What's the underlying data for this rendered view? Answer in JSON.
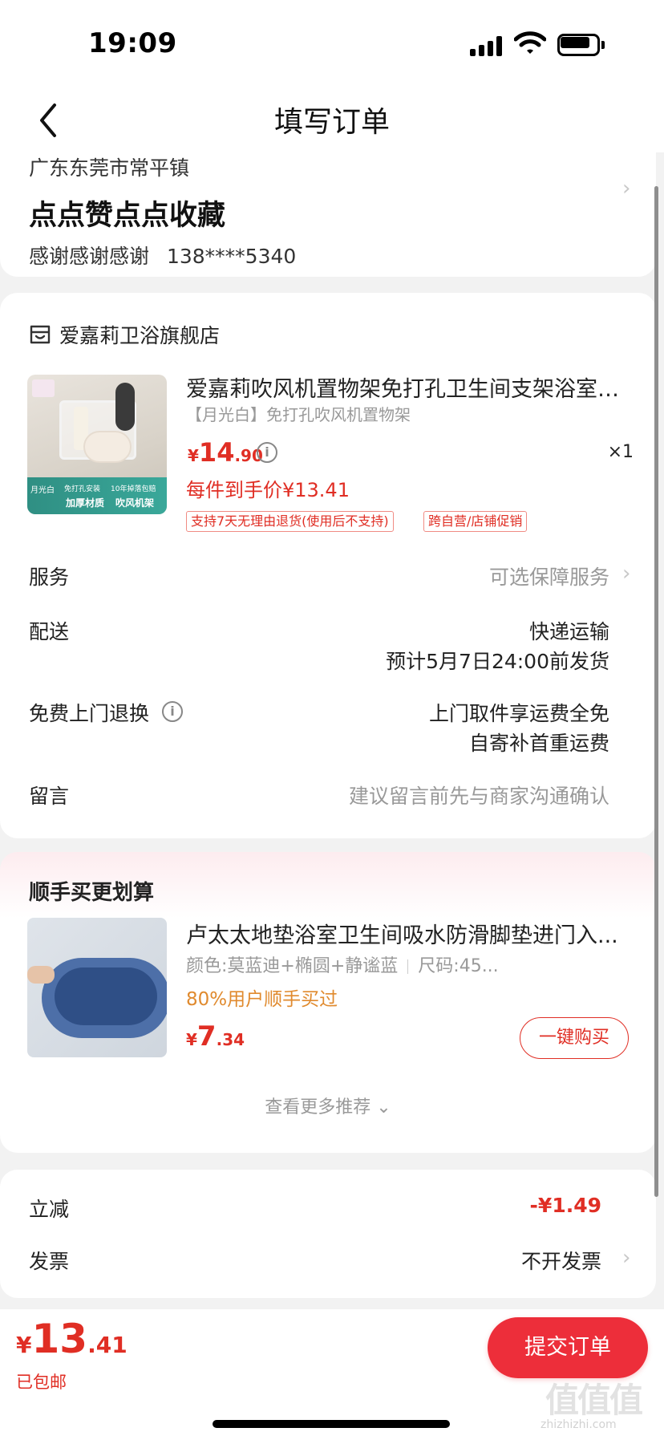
{
  "status_bar": {
    "time": "19:09"
  },
  "nav": {
    "title": "填写订单"
  },
  "address": {
    "region": "广东东莞市常平镇",
    "detail": "点点赞点点收藏",
    "name": "感谢感谢感谢",
    "phone": "138****5340"
  },
  "store": {
    "name": "爱嘉莉卫浴旗舰店"
  },
  "product": {
    "title": "爱嘉莉吹风机置物架免打孔卫生间支架浴室壁挂...",
    "spec": "【月光白】免打孔吹风机置物架",
    "price_symbol": "¥",
    "price_int": "14",
    "price_dec": ".90",
    "quantity": "×1",
    "unit_price": "每件到手价¥13.41",
    "tags": [
      "支持7天无理由退货(使用后不支持)",
      "跨自营/店铺促销"
    ],
    "image_labels": [
      "月光白",
      "免打孔安装",
      "10年掉落包赔",
      "加厚材质",
      "吹风机架"
    ]
  },
  "rows": {
    "service_label": "服务",
    "service_value": "可选保障服务",
    "delivery_label": "配送",
    "delivery_value": "快递运输",
    "delivery_eta": "预计5月7日24:00前发货",
    "return_label": "免费上门退换",
    "return_value_1": "上门取件享运费全免",
    "return_value_2": "自寄补首重运费",
    "message_label": "留言",
    "message_placeholder": "建议留言前先与商家沟通确认"
  },
  "upsell": {
    "title": "顺手买更划算",
    "item_title": "卢太太地垫浴室卫生间吸水防滑脚垫进门入...",
    "item_color": "颜色:莫蓝迪+椭圆+静谧蓝",
    "item_size": "尺码:45...",
    "buyers": "80%用户顺手买过",
    "price_symbol": "¥",
    "price_int": "7",
    "price_dec": ".34",
    "buy_label": "一键购买",
    "more_label": "查看更多推荐 ⌄"
  },
  "summary": {
    "discount_label": "立减",
    "discount_value": "-¥1.49",
    "invoice_label": "发票",
    "invoice_value": "不开发票"
  },
  "checkout": {
    "price_symbol": "¥",
    "price_int": "13",
    "price_dec": ".41",
    "shipping": "已包邮",
    "submit_label": "提交订单"
  },
  "watermark": {
    "text": "值值值",
    "sub": "zhizhizhi.com"
  },
  "colors": {
    "accent": "#e02e24",
    "button": "#ed2e3a",
    "buyers": "#e08a2e"
  }
}
